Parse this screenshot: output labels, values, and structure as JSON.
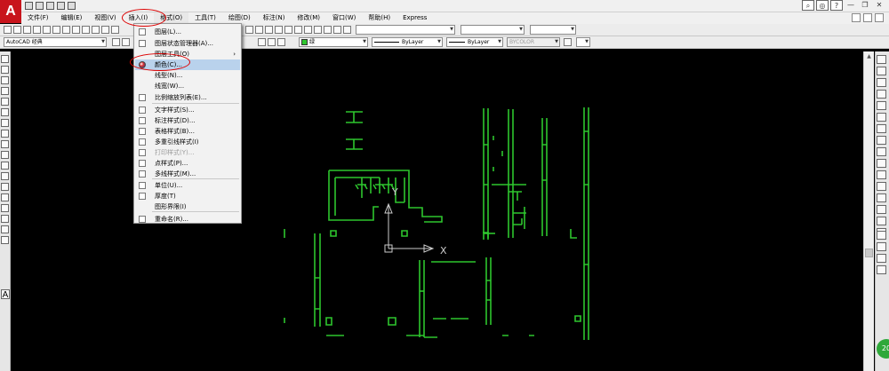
{
  "app": {
    "logo_letter": "A"
  },
  "menubar": {
    "items": [
      "文件(F)",
      "编辑(E)",
      "视图(V)",
      "插入(I)",
      "格式(O)",
      "工具(T)",
      "绘图(D)",
      "标注(N)",
      "修改(M)",
      "窗口(W)",
      "帮助(H)",
      "Express"
    ],
    "active_index": 4
  },
  "toolbar": {
    "workspace": "AutoCAD 经典",
    "layer": "绿",
    "linetype": "ByLayer",
    "lineweight": "ByLayer",
    "plot_style": "BYCOLOR"
  },
  "format_menu": {
    "items": [
      {
        "label": "图层(L)...",
        "icon": "layer-icon",
        "disabled": false
      },
      {
        "label": "图层状态管理器(A)...",
        "icon": "layer-state-icon",
        "disabled": false
      },
      {
        "label": "图层工具(O)",
        "icon": "",
        "disabled": false,
        "submenu": true
      },
      {
        "label": "颜色(C)...",
        "icon": "color-wheel-icon",
        "disabled": false,
        "highlighted": true
      },
      {
        "label": "线型(N)...",
        "icon": "",
        "disabled": false
      },
      {
        "label": "线宽(W)...",
        "icon": "",
        "disabled": false
      },
      {
        "label": "比例缩放列表(E)...",
        "icon": "scale-list-icon",
        "disabled": false
      },
      {
        "label": "文字样式(S)...",
        "icon": "text-style-icon",
        "disabled": false
      },
      {
        "label": "标注样式(D)...",
        "icon": "dim-style-icon",
        "disabled": false
      },
      {
        "label": "表格样式(B)...",
        "icon": "table-style-icon",
        "disabled": false
      },
      {
        "label": "多重引线样式(I)",
        "icon": "mleader-style-icon",
        "disabled": false
      },
      {
        "label": "打印样式(Y)...",
        "icon": "plot-style-icon",
        "disabled": true
      },
      {
        "label": "点样式(P)...",
        "icon": "point-style-icon",
        "disabled": false
      },
      {
        "label": "多线样式(M)...",
        "icon": "mline-style-icon",
        "disabled": false
      },
      {
        "label": "单位(U)...",
        "icon": "units-icon",
        "disabled": false
      },
      {
        "label": "厚度(T)",
        "icon": "thickness-icon",
        "disabled": false
      },
      {
        "label": "图形界限(I)",
        "icon": "",
        "disabled": false
      },
      {
        "label": "重命名(R)...",
        "icon": "rename-icon",
        "disabled": false
      }
    ]
  },
  "ucs": {
    "x_label": "X",
    "y_label": "Y"
  },
  "colors": {
    "drawing_line": "#2ec62e",
    "annotation": "#dd0000",
    "highlight": "#b9d2ec"
  }
}
